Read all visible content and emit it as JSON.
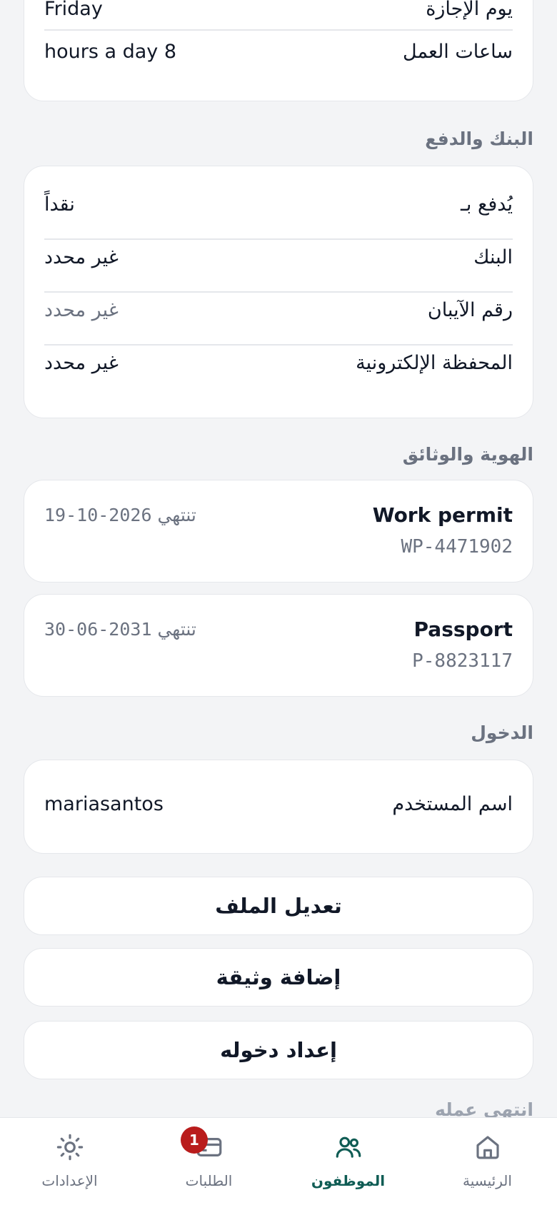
{
  "work_card": {
    "off_day_label": "يوم الإجازة",
    "off_day_value": "Friday",
    "hours_label": "ساعات العمل",
    "hours_value": "hours a day 8"
  },
  "bank": {
    "title": "البنك والدفع",
    "rows": [
      {
        "label": "يُدفع بـ",
        "value": "نقداً"
      },
      {
        "label": "البنك",
        "value": "غير محدد"
      },
      {
        "label": "رقم الآيبان",
        "value": "غير محدد"
      },
      {
        "label": "المحفظة الإلكترونية",
        "value": "غير محدد"
      }
    ]
  },
  "documents": {
    "title": "الهوية والوثائق",
    "items": [
      {
        "name": "Work permit",
        "number": "WP-4471902",
        "expires_label": "تنتهي",
        "expires_date": "19-10-2026"
      },
      {
        "name": "Passport",
        "number": "P-8823117",
        "expires_label": "تنتهي",
        "expires_date": "30-06-2031"
      }
    ]
  },
  "login": {
    "title": "الدخول",
    "username_label": "اسم المستخدم",
    "username_value": "mariasantos"
  },
  "actions": {
    "edit_profile": "تعديل الملف",
    "add_document": "إضافة وثيقة",
    "setup_login": "إعداد دخوله"
  },
  "next_section_peek": "انتهى عمله",
  "nav": {
    "home": "الرئيسية",
    "employees": "الموظفون",
    "requests": "الطلبات",
    "requests_badge": "1",
    "settings": "الإعدادات"
  },
  "colors": {
    "active": "#0f5c54",
    "badge": "#b91c1c",
    "background": "#f3f4f6"
  }
}
